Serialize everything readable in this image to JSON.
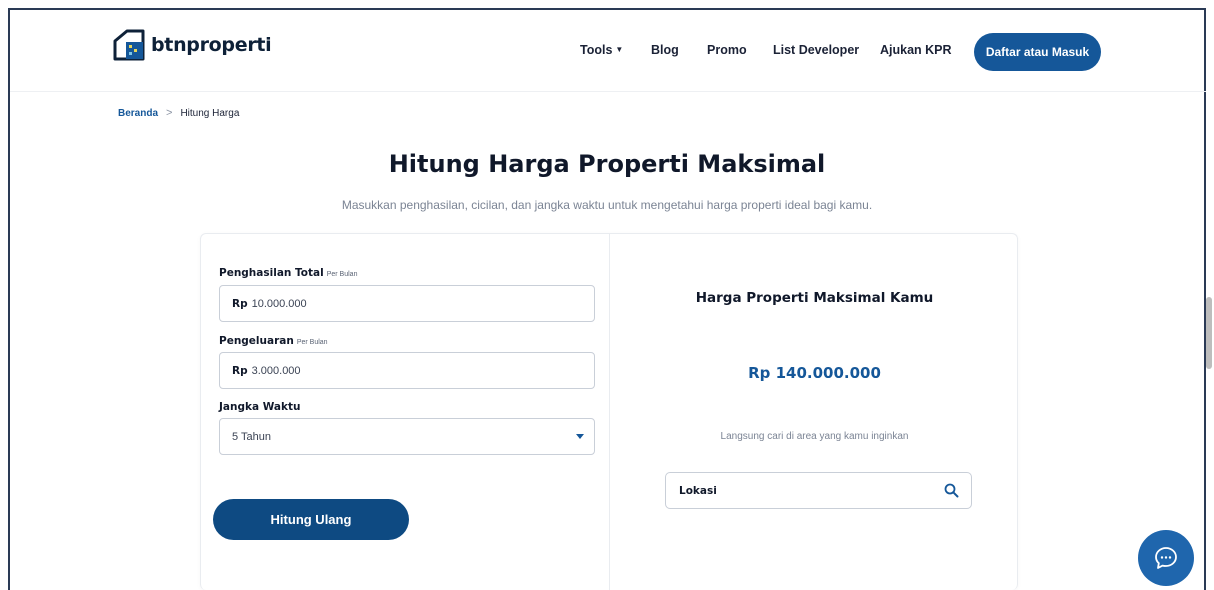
{
  "header": {
    "logo_text": "btnproperti",
    "nav": [
      {
        "label": "Tools",
        "has_dropdown": true
      },
      {
        "label": "Blog"
      },
      {
        "label": "Promo"
      },
      {
        "label": "List Developer"
      },
      {
        "label": "Ajukan KPR"
      }
    ],
    "login_label": "Daftar atau Masuk"
  },
  "breadcrumb": {
    "home": "Beranda",
    "separator": ">",
    "current": "Hitung Harga"
  },
  "page": {
    "title": "Hitung Harga Properti Maksimal",
    "subtitle": "Masukkan penghasilan, cicilan, dan jangka waktu untuk mengetahui harga properti ideal bagi kamu."
  },
  "form": {
    "income": {
      "label": "Penghasilan Total",
      "sublabel": "Per Bulan",
      "prefix": "Rp",
      "value": "10.000.000"
    },
    "expense": {
      "label": "Pengeluaran",
      "sublabel": "Per Bulan",
      "prefix": "Rp",
      "value": "3.000.000"
    },
    "term": {
      "label": "Jangka Waktu",
      "selected": "5 Tahun"
    },
    "submit_label": "Hitung Ulang"
  },
  "result": {
    "title": "Harga Properti Maksimal Kamu",
    "value": "Rp 140.000.000",
    "hint": "Langsung cari di area yang kamu inginkan",
    "location_placeholder": "Lokasi"
  },
  "colors": {
    "brand": "#155799",
    "button_dark": "#0e4a82",
    "chat_fab": "#1f66ad",
    "text_dark": "#10182a"
  },
  "icons": {
    "logo": "house-logo-icon",
    "dropdown": "caret-down-icon",
    "search": "search-icon",
    "chat": "chat-bubble-icon"
  }
}
